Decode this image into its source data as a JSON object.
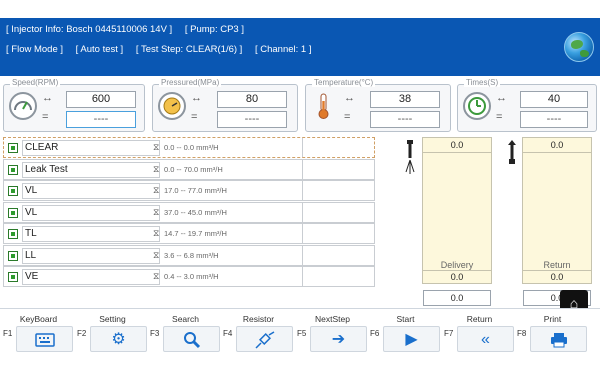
{
  "header": {
    "line1": [
      "[ Injector Info: Bosch  0445110006  14V ]",
      "[ Pump: CP3 ]"
    ],
    "line2": [
      "[ Flow Mode ]",
      "[ Auto test ]",
      "[ Test Step: CLEAR(1/6) ]",
      "[ Channel: 1 ]"
    ]
  },
  "measurements": [
    {
      "caption": "Speed(RPM)",
      "icon": "speedometer-icon",
      "value": "600",
      "set": "----"
    },
    {
      "caption": "Pressured(MPa)",
      "icon": "pressure-gauge-icon",
      "value": "80",
      "set": "----"
    },
    {
      "caption": "Temperature(°C)",
      "icon": "thermometer-icon",
      "value": "38",
      "set": "----"
    },
    {
      "caption": "Times(S)",
      "icon": "timer-icon",
      "value": "40",
      "set": "----"
    }
  ],
  "symbols": {
    "arrows": "↔",
    "equals": "="
  },
  "tests": [
    {
      "name": "CLEAR",
      "range": "0.0 -- 0.0 mm³/H"
    },
    {
      "name": "Leak Test",
      "range": "0.0 -- 70.0 mm³/H"
    },
    {
      "name": "VL",
      "range": "17.0 -- 77.0 mm³/H"
    },
    {
      "name": "VL",
      "range": "37.0 -- 45.0 mm³/H"
    },
    {
      "name": "TL",
      "range": "14.7 -- 19.7 mm³/H"
    },
    {
      "name": "LL",
      "range": "3.6 -- 6.8 mm³/H"
    },
    {
      "name": "VE",
      "range": "0.4 -- 3.0 mm³/H"
    }
  ],
  "delivery": {
    "label": "Delivery",
    "top": "0.0",
    "bottom": "0.0",
    "result": "0.0"
  },
  "return": {
    "label": "Return",
    "top": "0.0",
    "bottom": "0.0",
    "result": "0.0"
  },
  "fkeys": [
    {
      "fn": "F1",
      "label": "KeyBoard",
      "icon": "keyboard-icon"
    },
    {
      "fn": "F2",
      "label": "Setting",
      "icon": "gear-icon"
    },
    {
      "fn": "F3",
      "label": "Search",
      "icon": "search-icon"
    },
    {
      "fn": "F4",
      "label": "Resistor",
      "icon": "resistor-icon"
    },
    {
      "fn": "F5",
      "label": "NextStep",
      "icon": "arrow-right-icon"
    },
    {
      "fn": "F6",
      "label": "Start",
      "icon": "play-icon"
    },
    {
      "fn": "F7",
      "label": "Return",
      "icon": "double-chevron-left-icon"
    },
    {
      "fn": "F8",
      "label": "Print",
      "icon": "printer-icon"
    }
  ],
  "colors": {
    "header": "#0a57b3",
    "accent": "#1a6fcc",
    "panel": "#fdf8dc"
  }
}
